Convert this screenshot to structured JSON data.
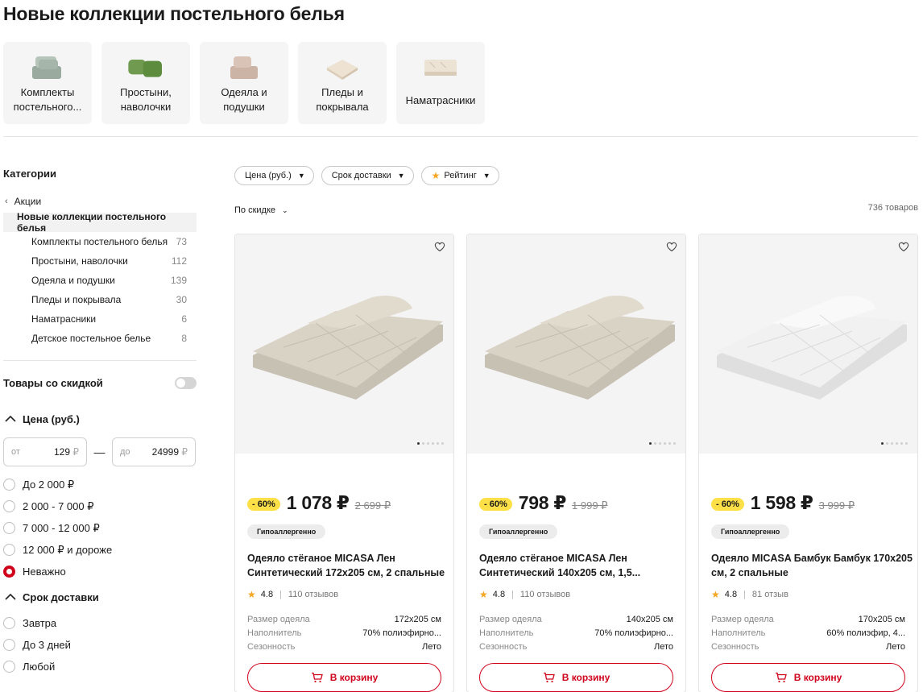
{
  "page": {
    "title": "Новые коллекции постельного белья"
  },
  "categories": [
    {
      "label": "Комплекты\nпостельного...",
      "icon": "bedding-set-icon"
    },
    {
      "label": "Простыни,\nнаволочки",
      "icon": "pillows-icon"
    },
    {
      "label": "Одеяла и\nподушки",
      "icon": "blanket-pillow-icon"
    },
    {
      "label": "Пледы и\nпокрывала",
      "icon": "throw-icon"
    },
    {
      "label": "Наматрасники",
      "icon": "mattress-pad-icon"
    }
  ],
  "sidebar": {
    "heading": "Категории",
    "back_label": "Акции",
    "current": "Новые коллекции постельного белья",
    "items": [
      {
        "label": "Комплекты постельного белья",
        "count": "73"
      },
      {
        "label": "Простыни, наволочки",
        "count": "112"
      },
      {
        "label": "Одеяла и подушки",
        "count": "139"
      },
      {
        "label": "Пледы и покрывала",
        "count": "30"
      },
      {
        "label": "Наматрасники",
        "count": "6"
      },
      {
        "label": "Детское постельное белье",
        "count": "8"
      }
    ],
    "discount_toggle": "Товары со скидкой",
    "price": {
      "heading": "Цена (руб.)",
      "from_placeholder": "от",
      "from_value": "129",
      "to_placeholder": "до",
      "to_value": "24999",
      "currency": "₽",
      "dash": "—",
      "options": [
        "До 2 000 ₽",
        "2 000 - 7 000 ₽",
        "7 000 - 12 000 ₽",
        "12 000 ₽ и дороже",
        "Неважно"
      ],
      "selected": "Неважно"
    },
    "delivery": {
      "heading": "Срок доставки",
      "options": [
        "Завтра",
        "До 3 дней",
        "Любой"
      ]
    }
  },
  "filters": {
    "price": "Цена (руб.)",
    "delivery": "Срок доставки",
    "rating": "Рейтинг"
  },
  "sort": {
    "label": "По скидке"
  },
  "total": "736 товаров",
  "products": [
    {
      "discount": "- 60%",
      "price": "1 078 ₽",
      "old_price": "2 699 ₽",
      "tag": "Гипоаллергенно",
      "name": "Одеяло стёганое MICASA Лен Синтетический 172х205 см, 2 спальные",
      "rating": "4.8",
      "reviews": "110 отзывов",
      "specs": [
        {
          "k": "Размер одеяла",
          "v": "172x205 см"
        },
        {
          "k": "Наполнитель",
          "v": "70% полиэфирно..."
        },
        {
          "k": "Сезонность",
          "v": "Лето"
        }
      ],
      "cart": "В корзину",
      "color": "#d9d3c6"
    },
    {
      "discount": "- 60%",
      "price": "798 ₽",
      "old_price": "1 999 ₽",
      "tag": "Гипоаллергенно",
      "name": "Одеяло стёганое MICASA Лен Синтетический 140х205 см, 1,5...",
      "rating": "4.8",
      "reviews": "110 отзывов",
      "specs": [
        {
          "k": "Размер одеяла",
          "v": "140x205 см"
        },
        {
          "k": "Наполнитель",
          "v": "70% полиэфирно..."
        },
        {
          "k": "Сезонность",
          "v": "Лето"
        }
      ],
      "cart": "В корзину",
      "color": "#d9d3c6"
    },
    {
      "discount": "- 60%",
      "price": "1 598 ₽",
      "old_price": "3 999 ₽",
      "tag": "Гипоаллергенно",
      "name": "Одеяло MICASA Бамбук Бамбук 170х205 см, 2 спальные",
      "rating": "4.8",
      "reviews": "81 отзыв",
      "specs": [
        {
          "k": "Размер одеяла",
          "v": "170x205 см"
        },
        {
          "k": "Наполнитель",
          "v": "60% полиэфир, 4..."
        },
        {
          "k": "Сезонность",
          "v": "Лето"
        }
      ],
      "cart": "В корзину",
      "color": "#f1f1f1"
    }
  ]
}
